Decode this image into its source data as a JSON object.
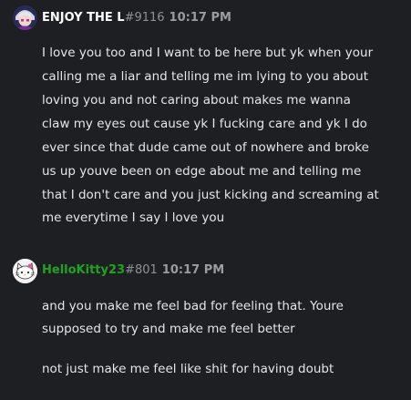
{
  "messages": [
    {
      "author": "ENJOY THE L",
      "tag": "#9116",
      "time": "10:17 PM",
      "name_color": "#ffffff",
      "avatar_icon": "anime-character-avatar",
      "lines": [
        "I love you too and I want to be here but yk when your",
        "calling me a liar and telling me im lying to you about",
        "loving you and not caring about makes me wanna",
        "claw my eyes out cause yk I fucking care and yk I do",
        "ever since that dude came out of nowhere and broke",
        "us up youve been on edge about me and telling me",
        "that I don't care and you just kicking and screaming at",
        "me everytime I say I love you"
      ]
    },
    {
      "author": "HelloKitty23",
      "tag": "#801",
      "time": "10:17 PM",
      "name_color": "#1fa31f",
      "avatar_icon": "hello-kitty-avatar",
      "lines": [
        "and you make me feel bad for feeling that. Youre",
        "supposed to try and make me feel better",
        "not just make me feel like shit for having doubt"
      ]
    }
  ]
}
